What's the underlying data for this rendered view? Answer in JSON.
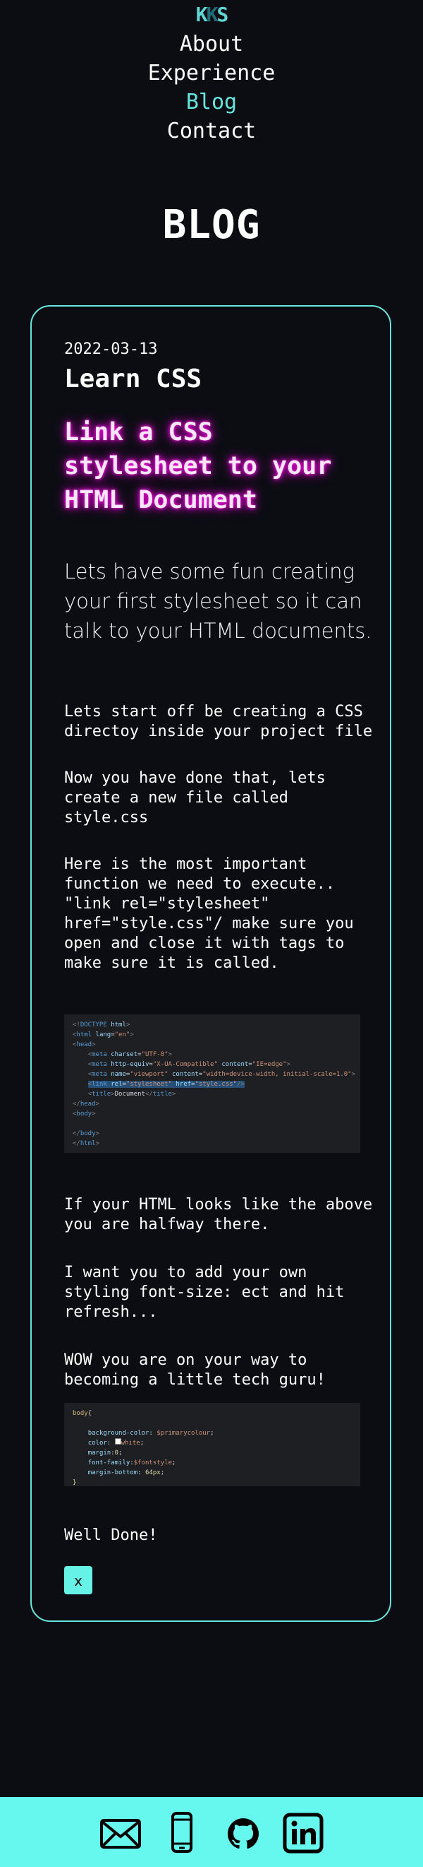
{
  "logo": {
    "text": "KKS"
  },
  "nav": {
    "items": [
      {
        "label": "About"
      },
      {
        "label": "Experience"
      },
      {
        "label": "Blog"
      },
      {
        "label": "Contact"
      }
    ]
  },
  "page_title": "BLOG",
  "post": {
    "date": "2022-03-13",
    "title": "Learn CSS",
    "headline": "Link a CSS stylesheet to your HTML Document",
    "intro": "Lets have some fun creating your first stylesheet so it can talk to your HTML documents.",
    "paragraphs": [
      "Lets start off be creating a CSS directoy inside your project file",
      "Now you have done that, lets create a new file called style.css",
      "Here is the most important function we need to execute.. \"link rel=\"stylesheet\" href=\"style.css\"/ make sure you open and close it with tags to make sure it is called.",
      "If your HTML looks like the above you are halfway there.",
      "I want you to add your own styling font-size: ect and hit refresh...",
      "WOW you are on your way to becoming a little tech guru!",
      "Well Done!"
    ],
    "close_label": "x"
  },
  "footer": {
    "icons": [
      "mail-icon",
      "phone-icon",
      "github-icon",
      "linkedin-icon"
    ]
  },
  "colors": {
    "background": "#0b0d12",
    "accent": "#66e6dd",
    "headline_glow": "#e000d0",
    "footer": "#66f7ef"
  }
}
